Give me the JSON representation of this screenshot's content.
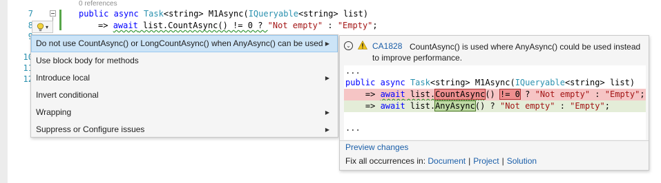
{
  "editor": {
    "line_numbers": [
      "7",
      "8",
      "9",
      "10",
      "11",
      "12"
    ],
    "references": "0 references",
    "line7": {
      "kw1": "public",
      "kw2": "async",
      "type1": "Task",
      "generic1": "<string>",
      "method": " M1Async(",
      "type2": "IQueryable",
      "generic2": "<string>",
      "param": " list)"
    },
    "line8": {
      "arrow": "=> ",
      "kw": "await",
      "call": " list.CountAsync() != 0 ? ",
      "str1": "\"Not empty\"",
      "colon": " : ",
      "str2": "\"Empty\"",
      "end": ";"
    }
  },
  "lightbulb": {
    "icon": "lightbulb-icon",
    "caret": "▾"
  },
  "menu": {
    "items": [
      {
        "label": "Do not use CountAsync() or LongCountAsync() when AnyAsync() can be used",
        "has_submenu": true,
        "selected": true
      },
      {
        "label": "Use block body for methods",
        "has_submenu": false
      },
      {
        "label": "Introduce local",
        "has_submenu": true
      },
      {
        "label": "Invert conditional",
        "has_submenu": false
      },
      {
        "label": "Wrapping",
        "has_submenu": true
      },
      {
        "label": "Suppress or Configure issues",
        "has_submenu": true
      }
    ],
    "submenu_arrow": "▶"
  },
  "preview": {
    "rule_id": "CA1828",
    "rule_text": "CountAsync() is used where AnyAsync() could be used instead to improve performance.",
    "ellipsis_top": "...",
    "ellipsis_bottom": "...",
    "signature": {
      "kw1": "public",
      "kw2": "async",
      "type1": "Task",
      "generic1": "<string>",
      "method": " M1Async(",
      "type2": "IQueryable",
      "generic2": "<string>",
      "param": " list)"
    },
    "removed": {
      "arrow": "    => ",
      "kw": "await",
      "pre": " list.",
      "call": "CountAsync",
      "mid": "() ",
      "op": "!= 0",
      "post": " ? ",
      "str1": "\"Not empty\"",
      "colon": " : ",
      "str2": "\"Empty\"",
      "end": ";"
    },
    "added": {
      "arrow": "    => ",
      "kw": "await",
      "pre": " list.",
      "call": "AnyAsync",
      "post": "() ? ",
      "str1": "\"Not empty\"",
      "colon": " : ",
      "str2": "\"Empty\"",
      "end": ";"
    },
    "preview_changes": "Preview changes",
    "fix_all_label": "Fix all occurrences in:",
    "fix_all_scopes": [
      "Document",
      "Project",
      "Solution"
    ],
    "separator": "|"
  },
  "colors": {
    "keyword": "#0000ff",
    "type": "#2b91af",
    "string": "#a31515",
    "link": "#1a5ea8",
    "selection": "#cce4f7",
    "removed_bg": "#f6c5c5",
    "added_bg": "#e4edd8"
  }
}
